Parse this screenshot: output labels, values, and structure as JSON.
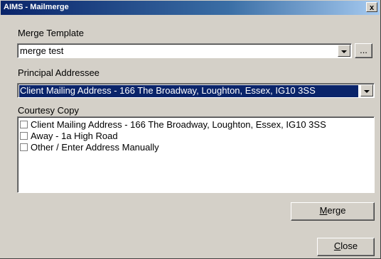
{
  "window": {
    "title": "AIMS - Mailmerge",
    "close_glyph": "x"
  },
  "merge_template": {
    "label": "Merge Template",
    "value": "merge test",
    "browse_label": "..."
  },
  "principal_addressee": {
    "label": "Principal Addressee",
    "value": "Client Mailing Address - 166 The Broadway, Loughton, Essex, IG10 3SS"
  },
  "courtesy_copy": {
    "label": "Courtesy Copy",
    "items": [
      {
        "label": "Client Mailing Address - 166 The Broadway, Loughton, Essex, IG10 3SS",
        "checked": false
      },
      {
        "label": "Away - 1a High Road",
        "checked": false
      },
      {
        "label": "Other / Enter Address Manually",
        "checked": false
      }
    ]
  },
  "buttons": {
    "merge": {
      "mnemonic": "M",
      "rest": "erge"
    },
    "close": {
      "mnemonic": "C",
      "rest": "lose"
    }
  }
}
